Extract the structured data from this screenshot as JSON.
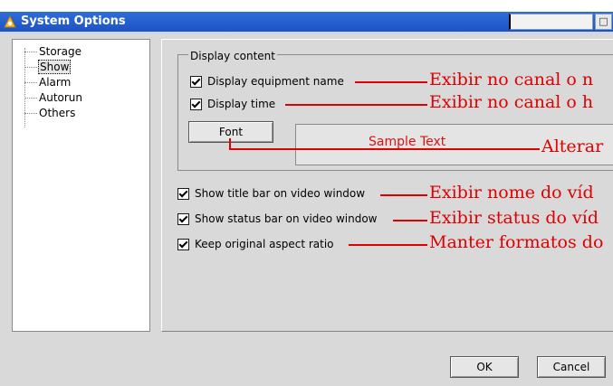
{
  "window": {
    "title": "System Options",
    "close_label": "□"
  },
  "tree": {
    "items": [
      "Storage",
      "Show",
      "Alarm",
      "Autorun",
      "Others"
    ],
    "selected": "Show"
  },
  "display_group": {
    "legend": "Display content",
    "equipment_name": "Display equipment name",
    "time": "Display time",
    "font_button": "Font",
    "sample_text": "Sample Text"
  },
  "options": {
    "title_bar": "Show title bar on video window",
    "status_bar": "Show status bar on video window",
    "aspect_ratio": "Keep original aspect ratio"
  },
  "buttons": {
    "ok": "OK",
    "cancel": "Cancel"
  },
  "annotations": {
    "a1": "Exibir no canal o n",
    "a2": "Exibir no canal o h",
    "a3": "Alterar",
    "a4": "Exibir nome do víd",
    "a5": "Exibir status do víd",
    "a6": "Manter formatos do"
  },
  "colors": {
    "title_bar": "#1d52c4",
    "annotation": "#e00000",
    "panel_bg": "#d9d9d9"
  }
}
